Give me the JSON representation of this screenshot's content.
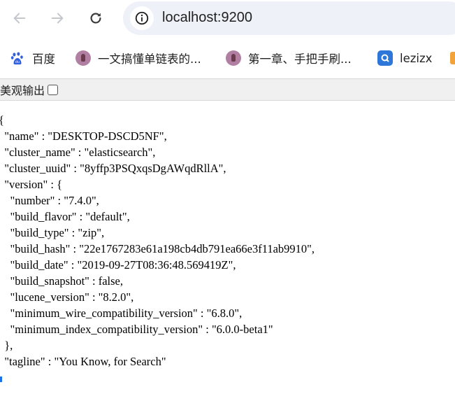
{
  "browser": {
    "url": "localhost:9200"
  },
  "bookmarks": [
    {
      "label": "百度",
      "icon": "baidu-paw-icon"
    },
    {
      "label": "一文搞懂单链表的...",
      "icon": "site-favicon-icon"
    },
    {
      "label": "第一章、手把手刷...",
      "icon": "site-favicon-icon"
    },
    {
      "label": "lezizx",
      "icon": "lezizx-favicon-icon"
    }
  ],
  "pretty_print": {
    "label": "美观输出",
    "checked": false
  },
  "json_lines": [
    "{",
    "  \"name\" : \"DESKTOP-DSCD5NF\",",
    "  \"cluster_name\" : \"elasticsearch\",",
    "  \"cluster_uuid\" : \"8yffp3PSQxqsDgAWqdRllA\",",
    "  \"version\" : {",
    "    \"number\" : \"7.4.0\",",
    "    \"build_flavor\" : \"default\",",
    "    \"build_type\" : \"zip\",",
    "    \"build_hash\" : \"22e1767283e61a198cb4db791ea66e3f11ab9910\",",
    "    \"build_date\" : \"2019-09-27T08:36:48.569419Z\",",
    "    \"build_snapshot\" : false,",
    "    \"lucene_version\" : \"8.2.0\",",
    "    \"minimum_wire_compatibility_version\" : \"6.8.0\",",
    "    \"minimum_index_compatibility_version\" : \"6.0.0-beta1\"",
    "  },",
    "  \"tagline\" : \"You Know, for Search\""
  ]
}
